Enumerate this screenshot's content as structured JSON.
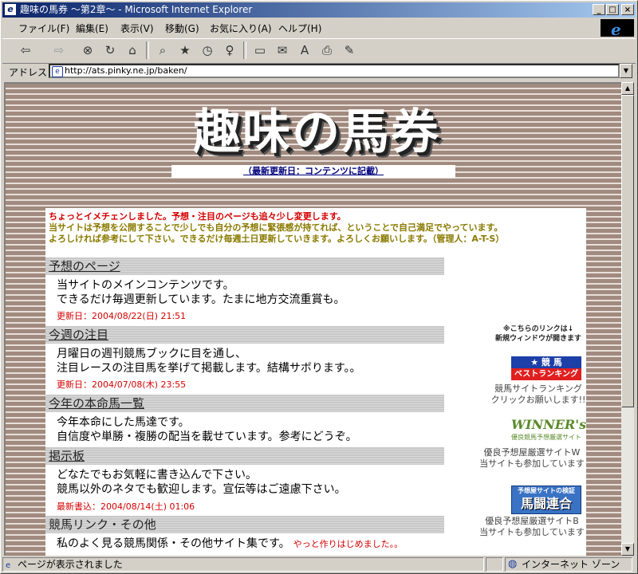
{
  "window": {
    "title": "趣味の馬券 ～第2章～ - Microsoft Internet Explorer",
    "minimize": "_",
    "maximize": "□",
    "close": "×"
  },
  "menu": [
    "ファイル(F)",
    "編集(E)",
    "表示(V)",
    "移動(G)",
    "お気に入り(A)",
    "ヘルプ(H)"
  ],
  "address": {
    "label": "アドレス",
    "url": "http://ats.pinky.ne.jp/baken/"
  },
  "status": {
    "text": "ページが表示されました",
    "zone": "インターネット ゾーン"
  },
  "page": {
    "logo": "趣味の馬券",
    "updated": "（最新更新日：コンテンツに記載）",
    "notice_red": "ちょっとイメチェンしました。予想・注目のページも追々少し変更します。",
    "notice_olive1": "当サイトは予想を公開することで少しでも自分の予想に緊張感が持てれば、ということで自己満足でやっています。",
    "notice_olive2": "よろしければ参考にして下さい。できるだけ毎週土日更新していきます。よろしくお願いします。（管理人：A-T-S）",
    "sections": [
      {
        "title": "予想のページ",
        "lines": [
          "当サイトのメインコンテンツです。",
          "できるだけ毎週更新しています。たまに地方交流重賞も。"
        ],
        "date": "更新日：2004/08/22(日) 21:51"
      },
      {
        "title": "今週の注目",
        "lines": [
          "月曜日の週刊競馬ブックに目を通し、",
          "注目レースの注目馬を挙げて掲載します。結構サボります。。"
        ],
        "date": "更新日：2004/07/08(木) 23:55"
      },
      {
        "title": "今年の本命馬一覧",
        "lines": [
          "今年本命にした馬達です。",
          "自信度や単勝・複勝の配当を載せています。参考にどうぞ。"
        ],
        "date": ""
      },
      {
        "title": "掲示板",
        "lines": [
          "どなたでもお気軽に書き込んで下さい。",
          "競馬以外のネタでも歓迎します。宣伝等はご遠慮下さい。"
        ],
        "date": "最新書込：2004/08/14(土) 01:06"
      },
      {
        "title": "競馬リンク・その他",
        "lines": [
          "私のよく見る競馬関係・その他サイト集です。"
        ],
        "date": "",
        "extra": "やっと作りはじめました。。"
      }
    ],
    "side": {
      "note1": "※こちらのリンクは↓",
      "note2": "新規ウィンドウが開きます",
      "b1_top": "★ 競 馬",
      "b1_bottom": "ベストランキング",
      "b1_cap1": "競馬サイトランキング",
      "b1_cap2": "クリックお願いします!!",
      "b2_title": "WINNER's",
      "b2_sub": "優良競馬予想厳選サイト",
      "b2_cap1": "優良予想屋厳選サイトW",
      "b2_cap2": "当サイトも参加しています",
      "b3_sub": "予想屋サイトの検証",
      "b3_title": "馬闘連合",
      "b3_cap1": "優良予想屋厳選サイトB",
      "b3_cap2": "当サイトも参加しています"
    }
  }
}
